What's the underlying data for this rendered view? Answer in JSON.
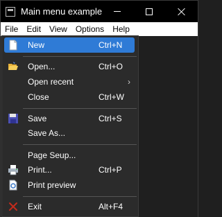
{
  "window": {
    "title": "Main menu example"
  },
  "menubar": {
    "items": [
      {
        "label": "File"
      },
      {
        "label": "Edit"
      },
      {
        "label": "View"
      },
      {
        "label": "Options"
      },
      {
        "label": "Help"
      }
    ]
  },
  "file_menu": {
    "items": [
      {
        "label": "New",
        "shortcut": "Ctrl+N",
        "icon": "new-document-icon",
        "highlighted": true
      },
      {
        "label": "Open...",
        "shortcut": "Ctrl+O",
        "icon": "open-folder-icon"
      },
      {
        "label": "Open recent",
        "shortcut": "",
        "submenu_arrow": "›"
      },
      {
        "label": "Close",
        "shortcut": "Ctrl+W"
      },
      {
        "label": "Save",
        "shortcut": "Ctrl+S",
        "icon": "save-disk-icon"
      },
      {
        "label": "Save As...",
        "shortcut": ""
      },
      {
        "label": "Page Seup...",
        "shortcut": ""
      },
      {
        "label": "Print...",
        "shortcut": "Ctrl+P",
        "icon": "printer-icon"
      },
      {
        "label": "Print preview",
        "shortcut": "",
        "icon": "print-preview-icon"
      },
      {
        "label": "Exit",
        "shortcut": "Alt+F4",
        "icon": "exit-x-icon"
      }
    ]
  },
  "colors": {
    "highlight": "#2f7bd6",
    "menu_background": "#2b2b2b",
    "menubar_background": "#ffffff",
    "titlebar_background": "#000000",
    "exit_icon": "#c42b1c"
  }
}
